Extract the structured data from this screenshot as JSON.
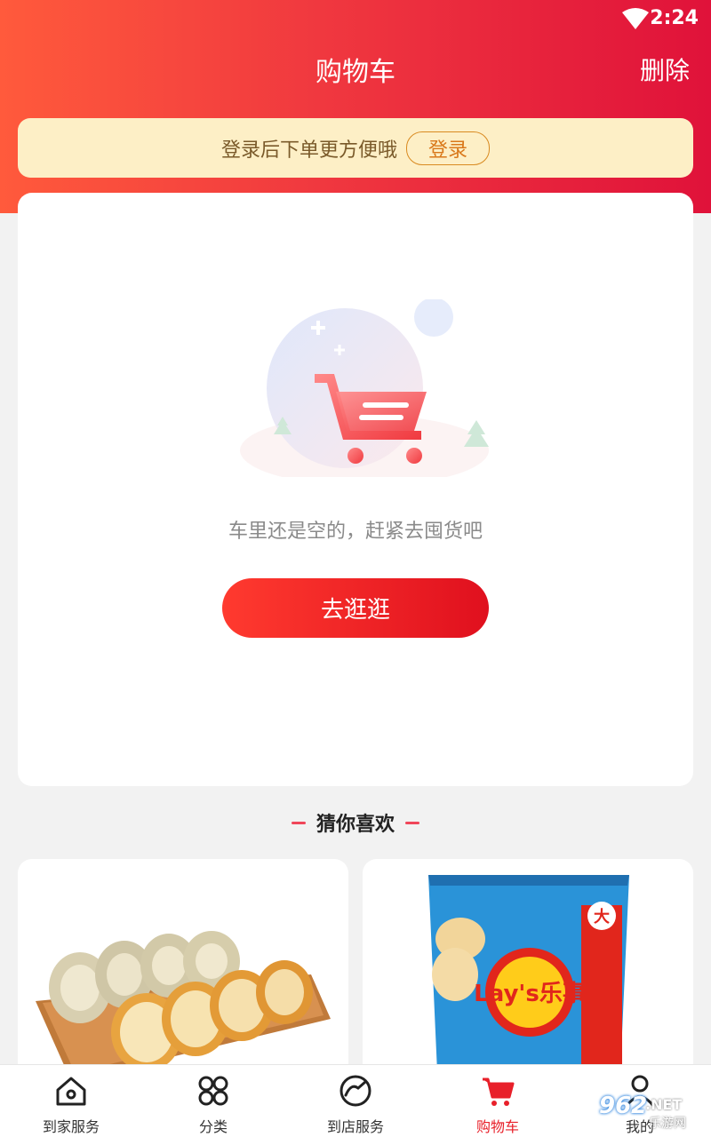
{
  "status_bar": {
    "time": "2:24"
  },
  "header": {
    "title": "购物车",
    "delete_label": "删除"
  },
  "login_banner": {
    "tip": "登录后下单更方便哦",
    "button_label": "登录"
  },
  "empty_cart": {
    "message": "车里还是空的，赶紧去囤货吧",
    "button_label": "去逛逛"
  },
  "recommend": {
    "title": "猜你喜欢"
  },
  "products": [
    {
      "name": "swiss-roll-cake"
    },
    {
      "name": "lays-chips",
      "brand_text": "Lay's乐事",
      "badge_text": "大包超值 就吃乐"
    }
  ],
  "tabs": [
    {
      "label": "到家服务",
      "icon": "home-icon"
    },
    {
      "label": "分类",
      "icon": "category-icon"
    },
    {
      "label": "到店服务",
      "icon": "store-service-icon"
    },
    {
      "label": "购物车",
      "icon": "cart-icon",
      "active": true
    },
    {
      "label": "我的",
      "icon": "user-icon"
    }
  ],
  "watermark": {
    "number": "962",
    "suffix": ".NET",
    "sub": "乐游网"
  },
  "colors": {
    "accent": "#e8202a",
    "header_start": "#ff5a3c",
    "header_end": "#e0123a",
    "banner_bg": "#fdefc6"
  }
}
